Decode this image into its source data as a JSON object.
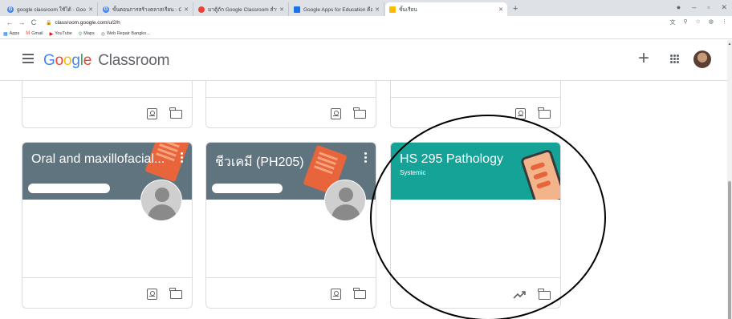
{
  "browser": {
    "tabs": [
      {
        "label": "google classroom ใช้ได้ - Google",
        "favicon_color": "#4285f4",
        "active": false
      },
      {
        "label": "ขั้นตอนการสร้างคลาสเรียน - Classroom",
        "favicon_color": "#4285f4",
        "active": false
      },
      {
        "label": "มาตู้ถัก Google Classroom สำหรับ",
        "favicon_color": "#ea4335",
        "active": false
      },
      {
        "label": "Google Apps for Education คืออะไร",
        "favicon_color": "#1a73e8",
        "active": false
      },
      {
        "label": "ชั้นเรียน",
        "favicon_color": "#fbbc04",
        "active": true
      }
    ],
    "new_tab": "+",
    "url": "classroom.google.com/u/2/h",
    "bookmarks": [
      {
        "label": "Apps",
        "icon": "apps-icon"
      },
      {
        "label": "Gmail",
        "icon": "gmail-icon"
      },
      {
        "label": "YouTube",
        "icon": "youtube-icon"
      },
      {
        "label": "Maps",
        "icon": "maps-icon"
      },
      {
        "label": "Web Repair Bangko...",
        "icon": "web-icon"
      }
    ]
  },
  "header": {
    "brand_google": "Google",
    "brand_classroom": "Classroom",
    "plus": "+"
  },
  "cards_top": [
    {
      "footer_icons": [
        "portrait-icon",
        "folder-icon"
      ]
    },
    {
      "footer_icons": [
        "portrait-icon",
        "folder-icon"
      ]
    },
    {
      "footer_icons": [
        "portrait-icon",
        "folder-icon"
      ]
    }
  ],
  "cards": [
    {
      "title": "Oral and maxillofacial...",
      "subtitle": "",
      "banner_color": "#607480",
      "footer_icons": [
        "portrait-icon",
        "folder-icon"
      ]
    },
    {
      "title": "ชีวเคมี (PH205)",
      "subtitle": "",
      "banner_color": "#607480",
      "footer_icons": [
        "portrait-icon",
        "folder-icon"
      ]
    },
    {
      "title": "HS 295 Pathology",
      "subtitle": "Systemic",
      "banner_color": "#14a396",
      "footer_icons": [
        "trending-icon",
        "folder-icon"
      ]
    }
  ]
}
